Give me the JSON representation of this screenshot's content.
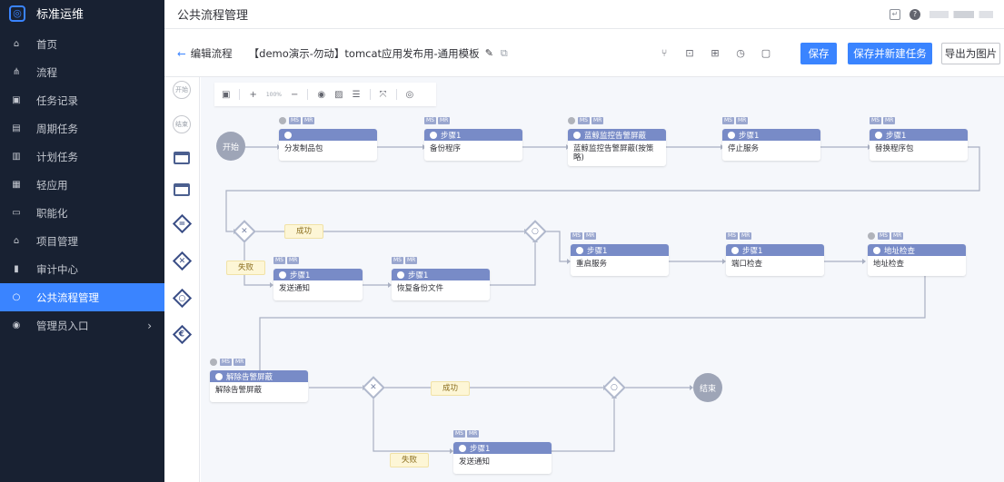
{
  "app": {
    "brand": "标准运维",
    "page_title": "公共流程管理"
  },
  "sidebar": {
    "items": [
      {
        "label": "首页",
        "icon": "home-icon"
      },
      {
        "label": "流程",
        "icon": "flow-icon"
      },
      {
        "label": "任务记录",
        "icon": "record-icon"
      },
      {
        "label": "周期任务",
        "icon": "periodic-icon"
      },
      {
        "label": "计划任务",
        "icon": "plan-icon"
      },
      {
        "label": "轻应用",
        "icon": "app-icon"
      },
      {
        "label": "职能化",
        "icon": "function-icon"
      },
      {
        "label": "项目管理",
        "icon": "project-icon"
      },
      {
        "label": "审计中心",
        "icon": "audit-icon"
      },
      {
        "label": "公共流程管理",
        "icon": "public-flow-icon",
        "active": true
      },
      {
        "label": "管理员入口",
        "icon": "admin-icon",
        "arrow": "›"
      }
    ]
  },
  "subbar": {
    "back_label": "编辑流程",
    "template_name": "【demo演示-勿动】tomcat应用发布用-通用模板",
    "save": "保存",
    "save_new_task": "保存并新建任务",
    "export": "导出为图片"
  },
  "palette": {
    "start": "开始",
    "end": "结束"
  },
  "canvas_toolbar": {
    "zoom": "100%"
  },
  "flow": {
    "start_label": "开始",
    "end_label": "结束",
    "tags": {
      "ms": "MS",
      "mr": "MR"
    },
    "nodes": {
      "n1": {
        "header": "",
        "body": "分发制品包"
      },
      "n2": {
        "header": "步骤1",
        "body": "备份程序"
      },
      "n3": {
        "header": "蓝鲸监控告警屏蔽",
        "body": "蓝鲸监控告警屏蔽(按策略)"
      },
      "n4": {
        "header": "步骤1",
        "body": "停止服务"
      },
      "n5": {
        "header": "步骤1",
        "body": "替换程序包"
      },
      "n6": {
        "header": "步骤1",
        "body": "发送通知"
      },
      "n7": {
        "header": "步骤1",
        "body": "恢复备份文件"
      },
      "n8": {
        "header": "步骤1",
        "body": "重启服务"
      },
      "n9": {
        "header": "步骤1",
        "body": "端口检查"
      },
      "n10": {
        "header": "地址检查",
        "body": "地址检查"
      },
      "n11": {
        "header": "解除告警屏蔽",
        "body": "解除告警屏蔽"
      },
      "n12": {
        "header": "步骤1",
        "body": "发送通知"
      }
    },
    "conditions": {
      "success": "成功",
      "failure": "失败"
    }
  }
}
